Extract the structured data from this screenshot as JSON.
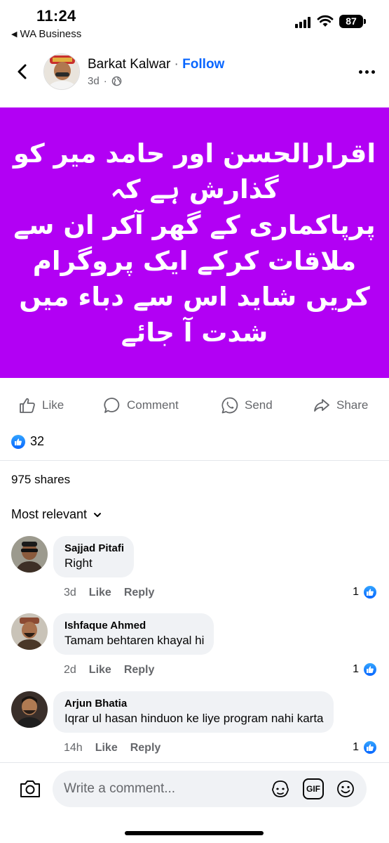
{
  "status_bar": {
    "time": "11:24",
    "back_app": "WA Business",
    "battery": "87"
  },
  "post": {
    "author": "Barkat Kalwar",
    "separator": " · ",
    "follow_label": "Follow",
    "age": "3d",
    "meta_separator": "·",
    "image_background": "#b200f4",
    "image_text_lines": [
      "اقرارالحسن اور حامد میر کو",
      "گذارش ہے کہ",
      "پرپاکماری کے گھر آکر ان سے",
      "ملاقات کرکے ایک پروگرام",
      "کریں شاید اس سے دباء میں",
      "شدت آ جائے"
    ]
  },
  "actions": {
    "like": "Like",
    "comment": "Comment",
    "send": "Send",
    "share": "Share"
  },
  "stats": {
    "reaction_count": "32",
    "shares": "975 shares"
  },
  "sort_label": "Most relevant",
  "comments": [
    {
      "name": "Sajjad Pitafi",
      "text": "Right",
      "age": "3d",
      "like": "Like",
      "reply": "Reply",
      "likes": "1"
    },
    {
      "name": "Ishfaque Ahmed",
      "text": "Tamam behtaren khayal hi",
      "age": "2d",
      "like": "Like",
      "reply": "Reply",
      "likes": "1"
    },
    {
      "name": "Arjun Bhatia",
      "text": "Iqrar ul hasan hinduon ke liye program nahi karta",
      "age": "14h",
      "like": "Like",
      "reply": "Reply",
      "likes": "1"
    }
  ],
  "composer": {
    "placeholder": "Write a comment...",
    "gif_label": "GIF"
  },
  "colors": {
    "accent": "#0866ff",
    "secondary_text": "#65676b",
    "bubble": "#f0f2f5"
  }
}
